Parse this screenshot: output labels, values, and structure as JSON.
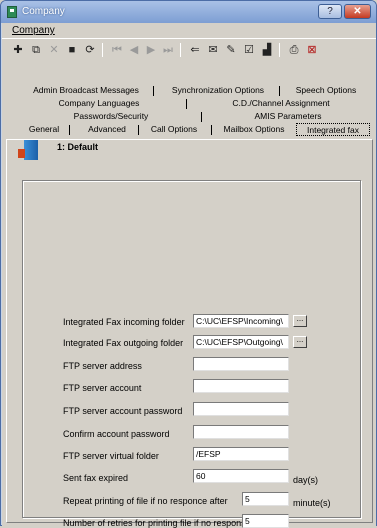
{
  "window": {
    "title": "Company"
  },
  "menubar": {
    "company": "Company"
  },
  "toolbar": {
    "icons": [
      "add-icon",
      "copy-icon",
      "delete-icon",
      "save-icon",
      "refresh-icon",
      "first-icon",
      "prev-icon",
      "next-icon",
      "last-icon",
      "back-icon",
      "email-icon",
      "tools-icon",
      "check-icon",
      "chart-icon",
      "print-icon",
      "exit-icon"
    ]
  },
  "tabs": {
    "row1": [
      "Admin Broadcast Messages",
      "Synchronization Options",
      "Speech Options"
    ],
    "row2": [
      "Company Languages",
      "C.D./Channel Assignment"
    ],
    "row3": [
      "Passwords/Security",
      "AMIS Parameters"
    ],
    "row4": [
      "General",
      "Advanced",
      "Call Options",
      "Mailbox Options",
      "Integrated fax"
    ]
  },
  "profile": {
    "label": "1: Default"
  },
  "form": {
    "incoming_label": "Integrated Fax incoming folder",
    "incoming_value": "C:\\UC\\EFSP\\Incoming\\",
    "outgoing_label": "Integrated Fax outgoing folder",
    "outgoing_value": "C:\\UC\\EFSP\\Outgoing\\",
    "ftp_address_label": "FTP server address",
    "ftp_address_value": "",
    "ftp_account_label": "FTP server account",
    "ftp_account_value": "",
    "ftp_password_label": "FTP server account password",
    "ftp_password_value": "",
    "confirm_label": "Confirm account password",
    "confirm_value": "",
    "virtual_folder_label": "FTP server virtual folder",
    "virtual_folder_value": "/EFSP",
    "sent_expired_label": "Sent fax expired",
    "sent_expired_value": "60",
    "sent_expired_unit": "day(s)",
    "repeat_label": "Repeat printing of file if no responce after",
    "repeat_value": "5",
    "repeat_unit": "minute(s)",
    "retries_label": "Number of retries for printing file if no response",
    "retries_value": "5",
    "browse_label": "..."
  }
}
